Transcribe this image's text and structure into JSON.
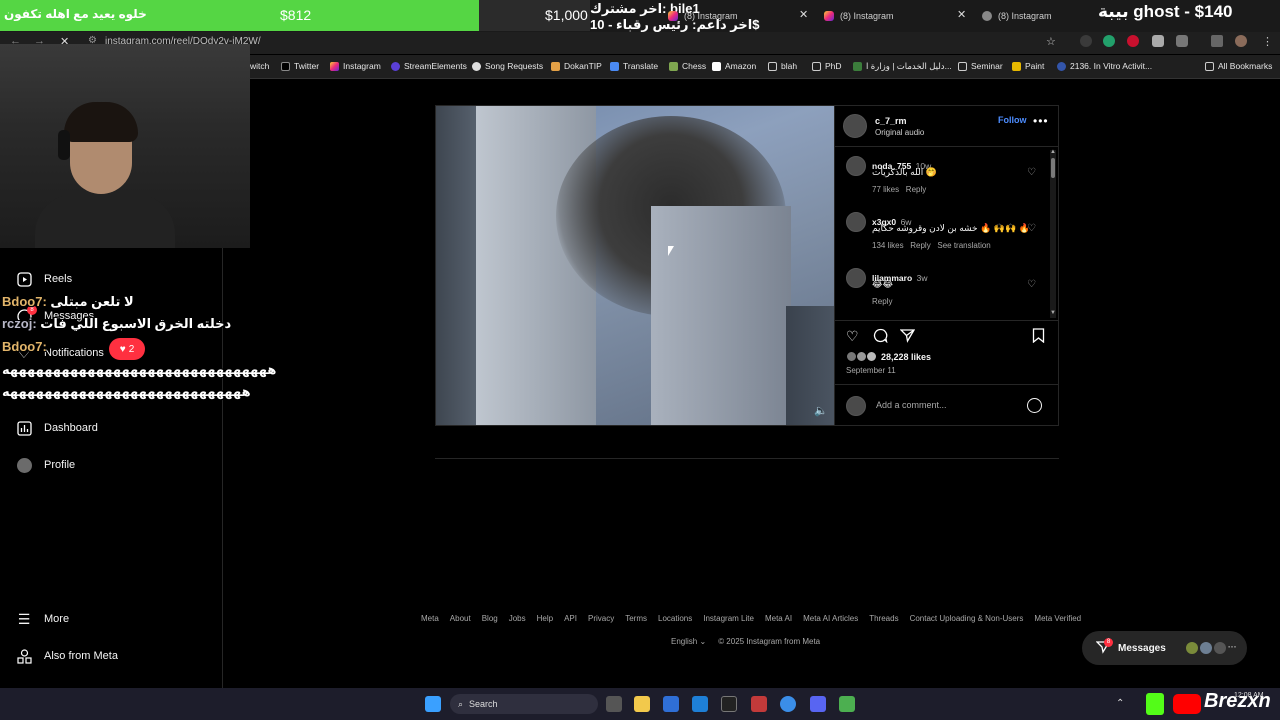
{
  "overlay": {
    "goal_left_text": "خلوه يعيد مع اهله تكفون",
    "goal_current": "$812",
    "goal_target": "$1,000",
    "goal_progress": 0.812,
    "sub_line1": "اخر مشترك: bile1",
    "sub_line2": "اخر داعم: رئيس رقباء - 10$",
    "ghost_label": "بيبة ghost - $140",
    "brand_text": "Brezxn"
  },
  "browser": {
    "tabs": [
      {
        "label": "(8) Instagram"
      },
      {
        "label": "(8) Instagram"
      },
      {
        "label": "(8) Instagram"
      }
    ],
    "url": "instagram.com/reel/DOdy2v-iM2W/",
    "bookmarks": [
      {
        "label": "witch",
        "icon": "twitch-icon"
      },
      {
        "label": "Twitter",
        "icon": "x-icon"
      },
      {
        "label": "Instagram",
        "icon": "instagram-icon"
      },
      {
        "label": "StreamElements",
        "icon": "streamelements-icon"
      },
      {
        "label": "Song Requests",
        "icon": "song-icon"
      },
      {
        "label": "DokanTIP",
        "icon": "dokan-icon"
      },
      {
        "label": "Translate",
        "icon": "translate-icon"
      },
      {
        "label": "Chess",
        "icon": "chess-icon"
      },
      {
        "label": "Amazon",
        "icon": "amazon-icon"
      },
      {
        "label": "blah",
        "icon": "folder-icon"
      },
      {
        "label": "PhD",
        "icon": "folder-icon"
      },
      {
        "label": "دليل الخدمات | وزارة ا...",
        "icon": "ministry-icon"
      },
      {
        "label": "Seminar",
        "icon": "folder-icon"
      },
      {
        "label": "Paint",
        "icon": "paint-icon"
      },
      {
        "label": "2136. In Vitro Activit...",
        "icon": "doc-icon"
      }
    ],
    "all_bookmarks": "All Bookmarks"
  },
  "chat": [
    {
      "nick": "Bdoo7:",
      "text": "لا تلعن مبتلى"
    },
    {
      "nick": "rczoj:",
      "text": "دخلته الخرق الاسبوع اللي فات"
    },
    {
      "nick": "Bdoo7:",
      "text": ""
    },
    {
      "nick": "",
      "text": "هههههههههههههههههههههههههههههههه"
    },
    {
      "nick": "",
      "text": "ههههههههههههههههههههههههههههه"
    }
  ],
  "sidebar": {
    "items": [
      {
        "label": "Reels",
        "icon": "reels-icon"
      },
      {
        "label": "Messages",
        "icon": "messenger-icon",
        "badge": "8"
      },
      {
        "label": "Notifications",
        "icon": "heart-icon"
      },
      {
        "label": "Dashboard",
        "icon": "dashboard-icon"
      },
      {
        "label": "Profile",
        "icon": "profile-avatar"
      }
    ],
    "notif_count": "2",
    "more": "More",
    "also_from_meta": "Also from Meta"
  },
  "post": {
    "username": "c_7_rm",
    "audio": "Original audio",
    "follow": "Follow",
    "comments": [
      {
        "user": "noda_755",
        "time": "10w",
        "text": "الله بالذكريات 🤭",
        "likes": "77 likes",
        "reply": "Reply",
        "translate": ""
      },
      {
        "user": "x3gx0",
        "time": "6w",
        "text": "خشه بن لادن وقروشه حكايم 🔥 🙌🙌 🔥",
        "likes": "134 likes",
        "reply": "Reply",
        "translate": "See translation"
      },
      {
        "user": "lilammaro",
        "time": "3w",
        "text": "😂😂",
        "likes": "",
        "reply": "Reply",
        "translate": ""
      }
    ],
    "likes": "28,228 likes",
    "date": "September 11",
    "add_comment_placeholder": "Add a comment..."
  },
  "footer": {
    "links": [
      "Meta",
      "About",
      "Blog",
      "Jobs",
      "Help",
      "API",
      "Privacy",
      "Terms",
      "Locations",
      "Instagram Lite",
      "Meta AI",
      "Meta AI Articles",
      "Threads",
      "Contact Uploading & Non-Users",
      "Meta Verified"
    ],
    "language": "English",
    "copyright": "© 2025 Instagram from Meta"
  },
  "messages_pill": {
    "label": "Messages",
    "badge": "8"
  },
  "taskbar": {
    "search": "Search",
    "time": "12:08 AM"
  },
  "colors": {
    "accent_blue": "#4d8dff",
    "notif_red": "#ff3040",
    "goal_green": "#55d644"
  }
}
